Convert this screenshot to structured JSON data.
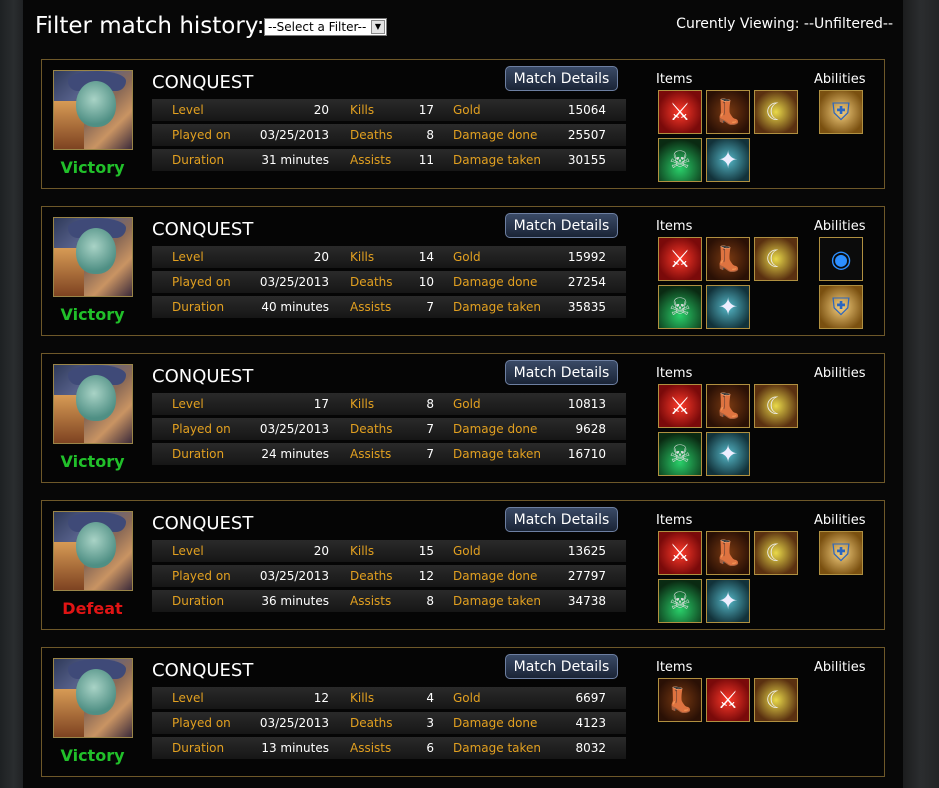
{
  "header": {
    "filter_title": "Filter match history:",
    "filter_selected": "--Select a Filter--",
    "viewing_text": "Curently Viewing: --Unfiltered--"
  },
  "labels": {
    "details_button": "Match Details",
    "items": "Items",
    "abilities": "Abilities",
    "level": "Level",
    "played_on": "Played on",
    "duration": "Duration",
    "kills": "Kills",
    "deaths": "Deaths",
    "assists": "Assists",
    "gold": "Gold",
    "damage_done": "Damage done",
    "damage_taken": "Damage taken"
  },
  "matches": [
    {
      "result": "Victory",
      "mode": "CONQUEST",
      "level": "20",
      "played_on": "03/25/2013",
      "duration": "31 minutes",
      "kills": "17",
      "deaths": "8",
      "assists": "11",
      "gold": "15064",
      "damage_done": "25507",
      "damage_taken": "30155",
      "items": [
        "axe-icon",
        "boots-icon",
        "blade-icon",
        "skull-icon",
        "frost-icon"
      ],
      "abilities": [
        "shield-icon"
      ]
    },
    {
      "result": "Victory",
      "mode": "CONQUEST",
      "level": "20",
      "played_on": "03/25/2013",
      "duration": "40 minutes",
      "kills": "14",
      "deaths": "10",
      "assists": "7",
      "gold": "15992",
      "damage_done": "27254",
      "damage_taken": "35835",
      "items": [
        "axe-icon",
        "boots-icon",
        "blade-icon",
        "skull-icon",
        "frost-icon"
      ],
      "abilities": [
        "orb-icon",
        "shield-icon"
      ]
    },
    {
      "result": "Victory",
      "mode": "CONQUEST",
      "level": "17",
      "played_on": "03/25/2013",
      "duration": "24 minutes",
      "kills": "8",
      "deaths": "7",
      "assists": "7",
      "gold": "10813",
      "damage_done": "9628",
      "damage_taken": "16710",
      "items": [
        "axe-icon",
        "boots-icon",
        "blade-icon",
        "skull-icon",
        "frost-icon"
      ],
      "abilities": []
    },
    {
      "result": "Defeat",
      "mode": "CONQUEST",
      "level": "20",
      "played_on": "03/25/2013",
      "duration": "36 minutes",
      "kills": "15",
      "deaths": "12",
      "assists": "8",
      "gold": "13625",
      "damage_done": "27797",
      "damage_taken": "34738",
      "items": [
        "axe-icon",
        "boots-icon",
        "blade-icon",
        "skull-icon",
        "frost-icon"
      ],
      "abilities": [
        "shield-icon"
      ]
    },
    {
      "result": "Victory",
      "mode": "CONQUEST",
      "level": "12",
      "played_on": "03/25/2013",
      "duration": "13 minutes",
      "kills": "4",
      "deaths": "3",
      "assists": "6",
      "gold": "6697",
      "damage_done": "4123",
      "damage_taken": "8032",
      "items": [
        "boots-icon",
        "axe-icon",
        "blade-icon"
      ],
      "abilities": []
    }
  ],
  "colors": {
    "label": "#e2a020",
    "victory": "#21c02a",
    "defeat": "#e01414",
    "border": "#6e5829"
  }
}
